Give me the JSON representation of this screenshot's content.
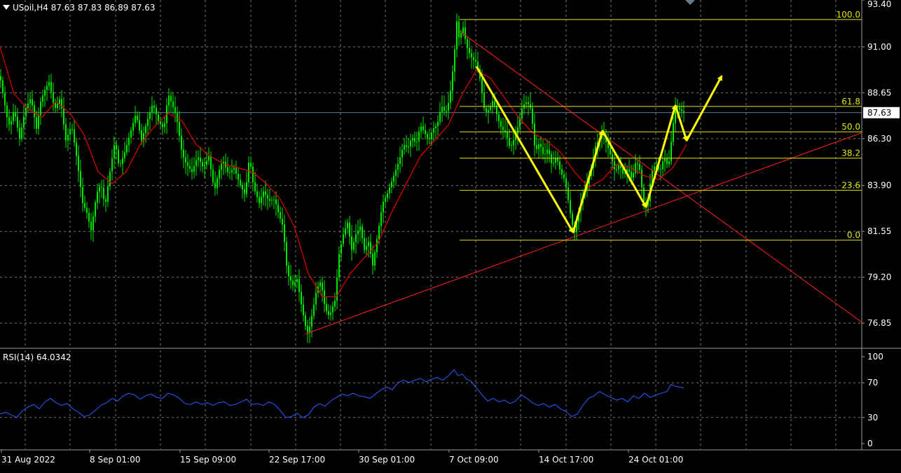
{
  "header": {
    "symbol_line": "USoil,H4  87.63 87.83 86.89 87.63"
  },
  "rsi_header": "RSI(14) 64.0342",
  "colors": {
    "background": "#000000",
    "grid": "#7a7a7a",
    "candle": "#00e600",
    "ma": "#e00000",
    "fib": "#e6e600",
    "rsi": "#2a5cff",
    "arrows": "#ffff00",
    "trendline": "#ff2020",
    "axis_text": "#ffffff"
  },
  "chart_data": [
    {
      "type": "candlestick",
      "symbol": "USoil",
      "timeframe": "H4",
      "current_price": "87.63",
      "ylim": [
        75.6,
        93.4
      ],
      "price_ticks": [
        "93.40",
        "91.00",
        "88.65",
        "86.30",
        "83.90",
        "81.55",
        "79.20",
        "76.85"
      ],
      "time_ticks": [
        "31 Aug 2022",
        "8 Sep 01:00",
        "15 Sep 09:00",
        "22 Sep 17:00",
        "30 Sep 01:00",
        "7 Oct 09:00",
        "14 Oct 17:00",
        "24 Oct 01:00"
      ],
      "price_path": [
        [
          0,
          89.5
        ],
        [
          6,
          88.2
        ],
        [
          10,
          87.4
        ],
        [
          14,
          86.9
        ],
        [
          20,
          87.8
        ],
        [
          28,
          86.3
        ],
        [
          36,
          87.8
        ],
        [
          44,
          88.4
        ],
        [
          52,
          86.8
        ],
        [
          58,
          88.2
        ],
        [
          64,
          88.8
        ],
        [
          70,
          89.2
        ],
        [
          78,
          87.8
        ],
        [
          86,
          88.4
        ],
        [
          94,
          86.2
        ],
        [
          102,
          87.0
        ],
        [
          110,
          85.2
        ],
        [
          118,
          83.0
        ],
        [
          124,
          82.5
        ],
        [
          130,
          81.6
        ],
        [
          138,
          83.5
        ],
        [
          144,
          84.0
        ],
        [
          150,
          82.8
        ],
        [
          156,
          84.4
        ],
        [
          164,
          86.2
        ],
        [
          170,
          84.8
        ],
        [
          178,
          85.6
        ],
        [
          186,
          86.6
        ],
        [
          194,
          87.6
        ],
        [
          202,
          86.2
        ],
        [
          210,
          87.2
        ],
        [
          218,
          88.1
        ],
        [
          226,
          87.2
        ],
        [
          234,
          86.8
        ],
        [
          240,
          88.6
        ],
        [
          246,
          88.0
        ],
        [
          252,
          87.4
        ],
        [
          260,
          85.5
        ],
        [
          266,
          85.0
        ],
        [
          274,
          84.6
        ],
        [
          282,
          85.4
        ],
        [
          290,
          84.8
        ],
        [
          298,
          85.4
        ],
        [
          306,
          83.6
        ],
        [
          312,
          84.6
        ],
        [
          318,
          85.2
        ],
        [
          326,
          84.5
        ],
        [
          334,
          84.8
        ],
        [
          342,
          84.0
        ],
        [
          350,
          83.4
        ],
        [
          356,
          85.4
        ],
        [
          362,
          83.8
        ],
        [
          370,
          83.0
        ],
        [
          376,
          83.6
        ],
        [
          384,
          83.1
        ],
        [
          392,
          83.2
        ],
        [
          398,
          82.4
        ],
        [
          404,
          81.8
        ],
        [
          410,
          79.4
        ],
        [
          418,
          78.8
        ],
        [
          424,
          79.1
        ],
        [
          430,
          77.8
        ],
        [
          436,
          76.7
        ],
        [
          440,
          76.3
        ],
        [
          446,
          77.4
        ],
        [
          452,
          78.6
        ],
        [
          458,
          79.0
        ],
        [
          464,
          77.6
        ],
        [
          470,
          77.2
        ],
        [
          478,
          78.0
        ],
        [
          484,
          80.4
        ],
        [
          490,
          81.4
        ],
        [
          496,
          82.0
        ],
        [
          502,
          80.6
        ],
        [
          508,
          81.4
        ],
        [
          514,
          81.8
        ],
        [
          520,
          80.6
        ],
        [
          526,
          81.0
        ],
        [
          532,
          79.8
        ],
        [
          540,
          81.6
        ],
        [
          546,
          83.0
        ],
        [
          552,
          83.4
        ],
        [
          558,
          84.0
        ],
        [
          564,
          84.6
        ],
        [
          570,
          85.2
        ],
        [
          576,
          86.0
        ],
        [
          582,
          85.8
        ],
        [
          588,
          86.4
        ],
        [
          594,
          86.0
        ],
        [
          600,
          87.0
        ],
        [
          606,
          86.6
        ],
        [
          612,
          86.2
        ],
        [
          618,
          86.8
        ],
        [
          624,
          87.0
        ],
        [
          630,
          88.0
        ],
        [
          636,
          87.6
        ],
        [
          642,
          88.4
        ],
        [
          648,
          90.4
        ],
        [
          652,
          92.3
        ],
        [
          656,
          91.2
        ],
        [
          660,
          92.2
        ],
        [
          664,
          91.4
        ],
        [
          668,
          90.8
        ],
        [
          674,
          90.4
        ],
        [
          680,
          90.2
        ],
        [
          686,
          89.2
        ],
        [
          692,
          87.6
        ],
        [
          698,
          87.8
        ],
        [
          704,
          88.3
        ],
        [
          710,
          87.4
        ],
        [
          716,
          86.8
        ],
        [
          722,
          86.6
        ],
        [
          728,
          85.8
        ],
        [
          734,
          86.3
        ],
        [
          740,
          87.0
        ],
        [
          746,
          88.0
        ],
        [
          752,
          88.2
        ],
        [
          758,
          87.8
        ],
        [
          764,
          85.6
        ],
        [
          770,
          86.1
        ],
        [
          776,
          85.4
        ],
        [
          782,
          85.8
        ],
        [
          788,
          84.9
        ],
        [
          794,
          85.4
        ],
        [
          800,
          84.6
        ],
        [
          806,
          84.2
        ],
        [
          810,
          83.4
        ],
        [
          816,
          82.0
        ],
        [
          820,
          81.5
        ],
        [
          826,
          82.6
        ],
        [
          832,
          83.4
        ],
        [
          838,
          84.0
        ],
        [
          844,
          84.8
        ],
        [
          850,
          85.9
        ],
        [
          856,
          86.3
        ],
        [
          860,
          86.7
        ],
        [
          866,
          86.0
        ],
        [
          872,
          85.4
        ],
        [
          878,
          84.6
        ],
        [
          884,
          85.0
        ],
        [
          890,
          84.4
        ],
        [
          896,
          84.8
        ],
        [
          902,
          84.2
        ],
        [
          908,
          85.2
        ],
        [
          914,
          84.6
        ],
        [
          918,
          83.0
        ],
        [
          924,
          82.8
        ],
        [
          930,
          84.6
        ],
        [
          936,
          85.0
        ],
        [
          942,
          84.6
        ],
        [
          948,
          85.4
        ],
        [
          954,
          84.8
        ],
        [
          960,
          86.8
        ],
        [
          964,
          88.0
        ],
        [
          970,
          87.8
        ],
        [
          976,
          87.63
        ]
      ],
      "ma_path": [
        [
          0,
          91.0
        ],
        [
          20,
          88.6
        ],
        [
          40,
          87.8
        ],
        [
          60,
          87.4
        ],
        [
          80,
          88.2
        ],
        [
          100,
          87.6
        ],
        [
          120,
          86.5
        ],
        [
          140,
          84.6
        ],
        [
          160,
          84.0
        ],
        [
          180,
          84.6
        ],
        [
          200,
          86.0
        ],
        [
          220,
          86.9
        ],
        [
          240,
          87.6
        ],
        [
          260,
          87.2
        ],
        [
          280,
          86.0
        ],
        [
          300,
          85.4
        ],
        [
          320,
          85.0
        ],
        [
          340,
          84.8
        ],
        [
          360,
          84.6
        ],
        [
          380,
          84.0
        ],
        [
          400,
          83.2
        ],
        [
          420,
          81.8
        ],
        [
          440,
          79.4
        ],
        [
          460,
          78.2
        ],
        [
          480,
          78.2
        ],
        [
          500,
          79.4
        ],
        [
          520,
          80.2
        ],
        [
          540,
          81.0
        ],
        [
          560,
          82.6
        ],
        [
          580,
          84.0
        ],
        [
          600,
          85.4
        ],
        [
          620,
          86.2
        ],
        [
          640,
          87.0
        ],
        [
          660,
          88.6
        ],
        [
          680,
          89.8
        ],
        [
          700,
          89.4
        ],
        [
          720,
          88.4
        ],
        [
          740,
          87.4
        ],
        [
          760,
          86.6
        ],
        [
          780,
          86.2
        ],
        [
          800,
          85.6
        ],
        [
          820,
          84.6
        ],
        [
          840,
          83.8
        ],
        [
          860,
          84.2
        ],
        [
          880,
          85.0
        ],
        [
          900,
          84.8
        ],
        [
          920,
          84.4
        ],
        [
          940,
          84.2
        ],
        [
          960,
          84.8
        ],
        [
          980,
          86.0
        ]
      ],
      "fibonacci": {
        "levels": [
          {
            "label": "100.0",
            "price": 92.4
          },
          {
            "label": "61.8",
            "price": 87.95
          },
          {
            "label": "50.0",
            "price": 86.65
          },
          {
            "label": "38.2",
            "price": 85.3
          },
          {
            "label": "23.6",
            "price": 83.65
          },
          {
            "label": "0.0",
            "price": 81.1
          }
        ],
        "x_start": 656,
        "x_end": 1230
      },
      "trendlines": [
        {
          "name": "rising-support",
          "from": [
            436,
            76.3
          ],
          "to": [
            1230,
            86.6
          ]
        },
        {
          "name": "falling-resistance",
          "from": [
            656,
            91.8
          ],
          "to": [
            1230,
            76.9
          ]
        }
      ],
      "pattern_arrows": [
        [
          [
            680,
            90.0
          ],
          [
            818,
            81.5
          ]
        ],
        [
          [
            818,
            81.5
          ],
          [
            860,
            86.7
          ]
        ],
        [
          [
            860,
            86.7
          ],
          [
            922,
            82.8
          ]
        ],
        [
          [
            922,
            82.8
          ],
          [
            964,
            88.0
          ]
        ],
        [
          [
            964,
            88.0
          ],
          [
            980,
            86.2
          ]
        ],
        [
          [
            980,
            86.2
          ],
          [
            1030,
            89.5
          ]
        ]
      ],
      "crosshair_price": 87.63
    },
    {
      "type": "line",
      "indicator": "RSI(14)",
      "value": "64.0342",
      "ylim": [
        0,
        100
      ],
      "ticks": [
        "100",
        "70",
        "30",
        "0"
      ],
      "values_path": [
        [
          0,
          34
        ],
        [
          8,
          36
        ],
        [
          16,
          33
        ],
        [
          24,
          30
        ],
        [
          32,
          38
        ],
        [
          40,
          42
        ],
        [
          48,
          45
        ],
        [
          56,
          40
        ],
        [
          64,
          48
        ],
        [
          72,
          52
        ],
        [
          80,
          47
        ],
        [
          88,
          44
        ],
        [
          96,
          46
        ],
        [
          104,
          40
        ],
        [
          112,
          36
        ],
        [
          120,
          31
        ],
        [
          128,
          33
        ],
        [
          136,
          38
        ],
        [
          144,
          44
        ],
        [
          152,
          47
        ],
        [
          160,
          52
        ],
        [
          168,
          49
        ],
        [
          176,
          55
        ],
        [
          184,
          58
        ],
        [
          192,
          56
        ],
        [
          200,
          51
        ],
        [
          208,
          55
        ],
        [
          216,
          57
        ],
        [
          224,
          53
        ],
        [
          232,
          52
        ],
        [
          240,
          58
        ],
        [
          248,
          56
        ],
        [
          256,
          52
        ],
        [
          264,
          46
        ],
        [
          272,
          45
        ],
        [
          280,
          48
        ],
        [
          288,
          45
        ],
        [
          296,
          47
        ],
        [
          304,
          44
        ],
        [
          312,
          47
        ],
        [
          320,
          48
        ],
        [
          328,
          44
        ],
        [
          336,
          45
        ],
        [
          344,
          48
        ],
        [
          352,
          51
        ],
        [
          360,
          45
        ],
        [
          368,
          46
        ],
        [
          376,
          44
        ],
        [
          384,
          48
        ],
        [
          392,
          45
        ],
        [
          400,
          38
        ],
        [
          408,
          30
        ],
        [
          416,
          31
        ],
        [
          424,
          35
        ],
        [
          432,
          30
        ],
        [
          440,
          33
        ],
        [
          448,
          42
        ],
        [
          456,
          46
        ],
        [
          464,
          43
        ],
        [
          472,
          49
        ],
        [
          480,
          53
        ],
        [
          488,
          57
        ],
        [
          496,
          55
        ],
        [
          504,
          58
        ],
        [
          512,
          55
        ],
        [
          520,
          54
        ],
        [
          528,
          52
        ],
        [
          536,
          57
        ],
        [
          544,
          62
        ],
        [
          552,
          65
        ],
        [
          560,
          62
        ],
        [
          568,
          70
        ],
        [
          576,
          73
        ],
        [
          584,
          70
        ],
        [
          592,
          73
        ],
        [
          600,
          75
        ],
        [
          608,
          71
        ],
        [
          616,
          74
        ],
        [
          624,
          76
        ],
        [
          632,
          73
        ],
        [
          640,
          78
        ],
        [
          648,
          85
        ],
        [
          654,
          78
        ],
        [
          660,
          80
        ],
        [
          666,
          74
        ],
        [
          672,
          72
        ],
        [
          680,
          64
        ],
        [
          688,
          56
        ],
        [
          696,
          49
        ],
        [
          704,
          52
        ],
        [
          712,
          48
        ],
        [
          720,
          50
        ],
        [
          728,
          46
        ],
        [
          736,
          49
        ],
        [
          744,
          56
        ],
        [
          752,
          52
        ],
        [
          760,
          47
        ],
        [
          768,
          44
        ],
        [
          776,
          46
        ],
        [
          784,
          42
        ],
        [
          792,
          45
        ],
        [
          800,
          40
        ],
        [
          808,
          37
        ],
        [
          816,
          31
        ],
        [
          824,
          34
        ],
        [
          832,
          44
        ],
        [
          840,
          52
        ],
        [
          848,
          55
        ],
        [
          856,
          60
        ],
        [
          864,
          56
        ],
        [
          872,
          53
        ],
        [
          880,
          50
        ],
        [
          888,
          52
        ],
        [
          896,
          48
        ],
        [
          904,
          55
        ],
        [
          912,
          52
        ],
        [
          920,
          58
        ],
        [
          928,
          53
        ],
        [
          936,
          56
        ],
        [
          944,
          58
        ],
        [
          952,
          60
        ],
        [
          958,
          68
        ],
        [
          964,
          66
        ],
        [
          970,
          65
        ],
        [
          976,
          64
        ]
      ]
    }
  ]
}
